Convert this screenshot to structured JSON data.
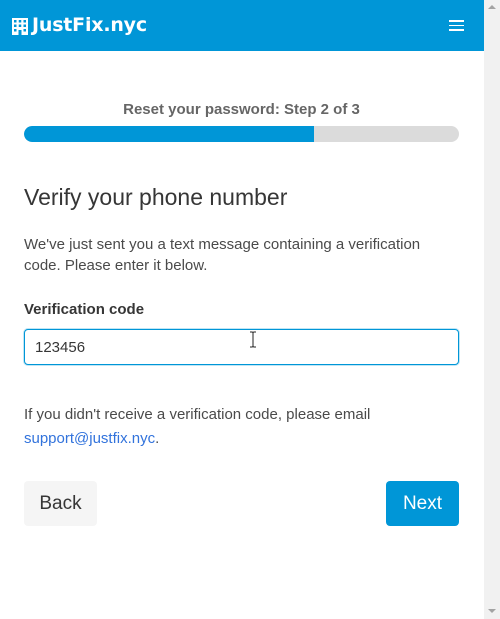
{
  "navbar": {
    "brand": "JustFix.nyc",
    "brand_icon": "building-icon",
    "menu_icon": "hamburger-menu-icon",
    "background": "#0096d7"
  },
  "progress": {
    "step_label": "Reset your password: Step 2 of 3",
    "fraction": 0.667
  },
  "main": {
    "title": "Verify your phone number",
    "description": "We've just sent you a text message containing a verification code. Please enter it below.",
    "field_label": "Verification code",
    "field_value": "123456",
    "help_text": "If you didn't receive a verification code, please email ",
    "help_link": "support@justfix.nyc",
    "help_suffix": "."
  },
  "buttons": {
    "back": "Back",
    "next": "Next"
  },
  "colors": {
    "accent": "#0096d7",
    "link": "#3273dc"
  }
}
